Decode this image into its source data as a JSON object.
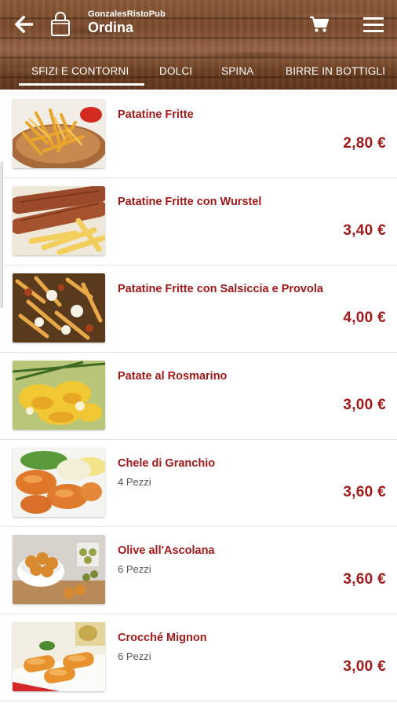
{
  "header": {
    "app_name": "GonzalesRistoPub",
    "title": "Ordina",
    "icons": {
      "back": "back-arrow-icon",
      "bag": "shopping-bag-icon",
      "cart": "cart-icon",
      "menu": "hamburger-menu-icon"
    }
  },
  "tabs": [
    {
      "label": "SFIZI E CONTORNI",
      "active": true
    },
    {
      "label": "DOLCI",
      "active": false
    },
    {
      "label": "SPINA",
      "active": false
    },
    {
      "label": "BIRRE IN BOTTIGLI",
      "active": false
    }
  ],
  "items": [
    {
      "name": "Patatine Fritte",
      "note": "",
      "price": "2,80 €",
      "image": "fries-image"
    },
    {
      "name": "Patatine Fritte con Wurstel",
      "note": "",
      "price": "3,40 €",
      "image": "fries-wurstel-image"
    },
    {
      "name": "Patatine Fritte con Salsiccia e Provola",
      "note": "",
      "price": "4,00 €",
      "image": "fries-sausage-image"
    },
    {
      "name": "Patate al Rosmarino",
      "note": "",
      "price": "3,00 €",
      "image": "rosemary-potatoes-image"
    },
    {
      "name": "Chele di Granchio",
      "note": "4 Pezzi",
      "price": "3,60 €",
      "image": "crab-claws-image"
    },
    {
      "name": "Olive all'Ascolana",
      "note": "6 Pezzi",
      "price": "3,60 €",
      "image": "ascolana-olives-image"
    },
    {
      "name": "Crocché Mignon",
      "note": "6 Pezzi",
      "price": "3,00 €",
      "image": "croquettes-image"
    }
  ],
  "colors": {
    "accent": "#a01818",
    "header_wood": "#7a4a2c",
    "text_secondary": "#555555"
  }
}
